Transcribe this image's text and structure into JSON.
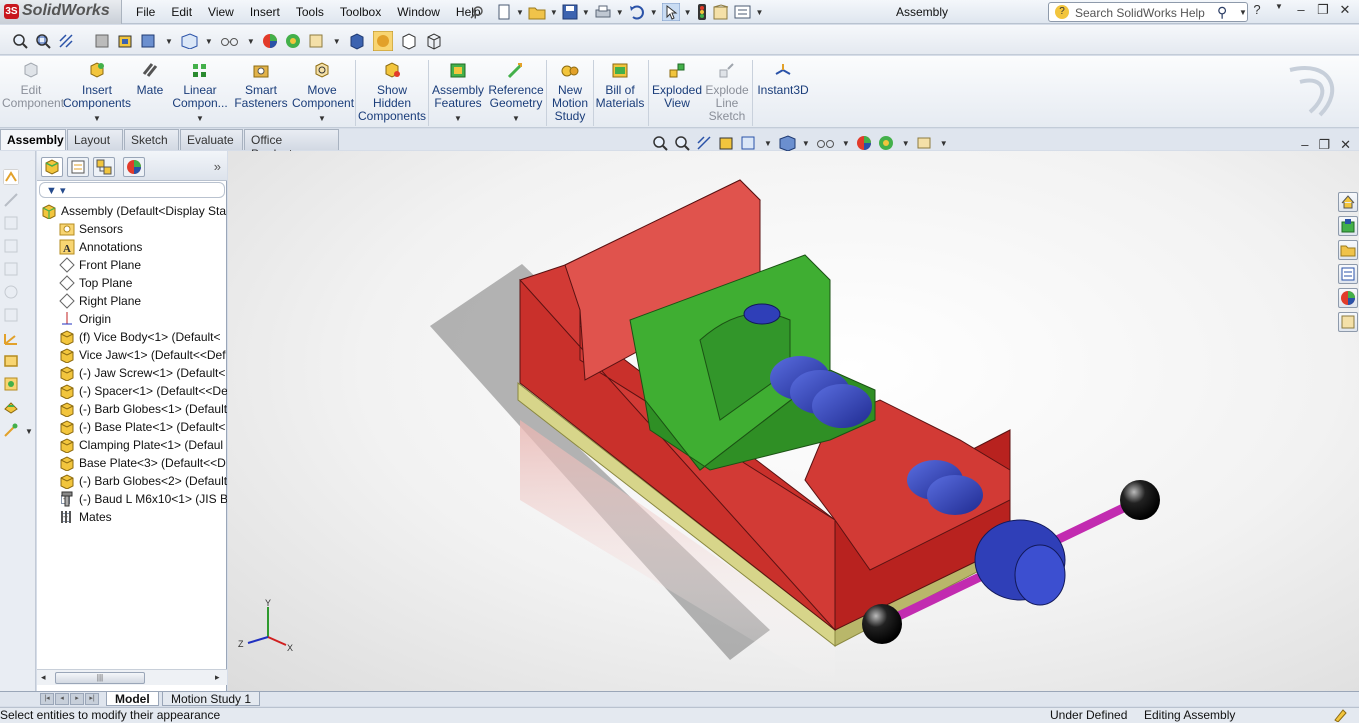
{
  "app": {
    "name": "SolidWorks",
    "window_title": "Assembly"
  },
  "menu": [
    "File",
    "Edit",
    "View",
    "Insert",
    "Tools",
    "Toolbox",
    "Window",
    "Help"
  ],
  "search": {
    "placeholder": "Search SolidWorks Help"
  },
  "command_manager": {
    "items": [
      {
        "label": "Edit Component",
        "icon": "edit-component-icon",
        "enabled": false
      },
      {
        "label": "Insert Components",
        "icon": "insert-components-icon",
        "enabled": true
      },
      {
        "label": "Mate",
        "icon": "mate-icon",
        "enabled": true
      },
      {
        "label": "Linear Compon...",
        "icon": "linear-pattern-icon",
        "enabled": true
      },
      {
        "label": "Smart Fasteners",
        "icon": "smart-fasteners-icon",
        "enabled": true
      },
      {
        "label": "Move Component",
        "icon": "move-component-icon",
        "enabled": true
      },
      {
        "label": "Show Hidden Components",
        "icon": "show-hidden-icon",
        "enabled": true
      },
      {
        "label": "Assembly Features",
        "icon": "assembly-features-icon",
        "enabled": true
      },
      {
        "label": "Reference Geometry",
        "icon": "reference-geometry-icon",
        "enabled": true
      },
      {
        "label": "New Motion Study",
        "icon": "motion-study-icon",
        "enabled": true
      },
      {
        "label": "Bill of Materials",
        "icon": "bom-icon",
        "enabled": true
      },
      {
        "label": "Exploded View",
        "icon": "exploded-view-icon",
        "enabled": true
      },
      {
        "label": "Explode Line Sketch",
        "icon": "explode-line-icon",
        "enabled": false
      },
      {
        "label": "Instant3D",
        "icon": "instant3d-icon",
        "enabled": true
      }
    ]
  },
  "tabs": [
    "Assembly",
    "Layout",
    "Sketch",
    "Evaluate",
    "Office Products"
  ],
  "active_tab": "Assembly",
  "feature_tree": {
    "root": "Assembly  (Default<Display Sta",
    "items": [
      {
        "label": "Sensors",
        "icon": "sensors-icon",
        "expandable": false
      },
      {
        "label": "Annotations",
        "icon": "annotations-icon",
        "expandable": true
      },
      {
        "label": "Front Plane",
        "icon": "plane-icon",
        "expandable": false
      },
      {
        "label": "Top Plane",
        "icon": "plane-icon",
        "expandable": false
      },
      {
        "label": "Right Plane",
        "icon": "plane-icon",
        "expandable": false
      },
      {
        "label": "Origin",
        "icon": "origin-icon",
        "expandable": false
      },
      {
        "label": "(f) Vice Body<1> (Default<",
        "icon": "part-icon",
        "expandable": true
      },
      {
        "label": "Vice Jaw<1> (Default<<Def",
        "icon": "part-icon",
        "expandable": true
      },
      {
        "label": "(-) Jaw Screw<1> (Default<",
        "icon": "part-icon",
        "expandable": true
      },
      {
        "label": "(-) Spacer<1> (Default<<De",
        "icon": "part-icon",
        "expandable": true
      },
      {
        "label": "(-) Barb Globes<1> (Default",
        "icon": "part-icon",
        "expandable": true
      },
      {
        "label": "(-) Base Plate<1> (Default<",
        "icon": "part-icon",
        "expandable": true
      },
      {
        "label": "Clamping Plate<1> (Defaul",
        "icon": "part-icon",
        "expandable": true
      },
      {
        "label": "Base Plate<3> (Default<<D",
        "icon": "part-icon",
        "expandable": true
      },
      {
        "label": "(-) Barb Globes<2> (Default",
        "icon": "part-icon",
        "expandable": true
      },
      {
        "label": "(-) Baud L M6x10<1> (JIS B",
        "icon": "fastener-icon",
        "expandable": true
      },
      {
        "label": "Mates",
        "icon": "mates-icon",
        "expandable": true
      }
    ]
  },
  "bottom_tabs": [
    "Model",
    "Motion Study 1"
  ],
  "status": {
    "message": "Select entities to modify their appearance",
    "definition": "Under Defined",
    "mode": "Editing Assembly"
  },
  "colors": {
    "vice_body": "#d23a35",
    "vice_jaw": "#3fae32",
    "screw": "#2f3fb8",
    "handle": "#c22bb0",
    "base_plate": "#d7d58a"
  }
}
